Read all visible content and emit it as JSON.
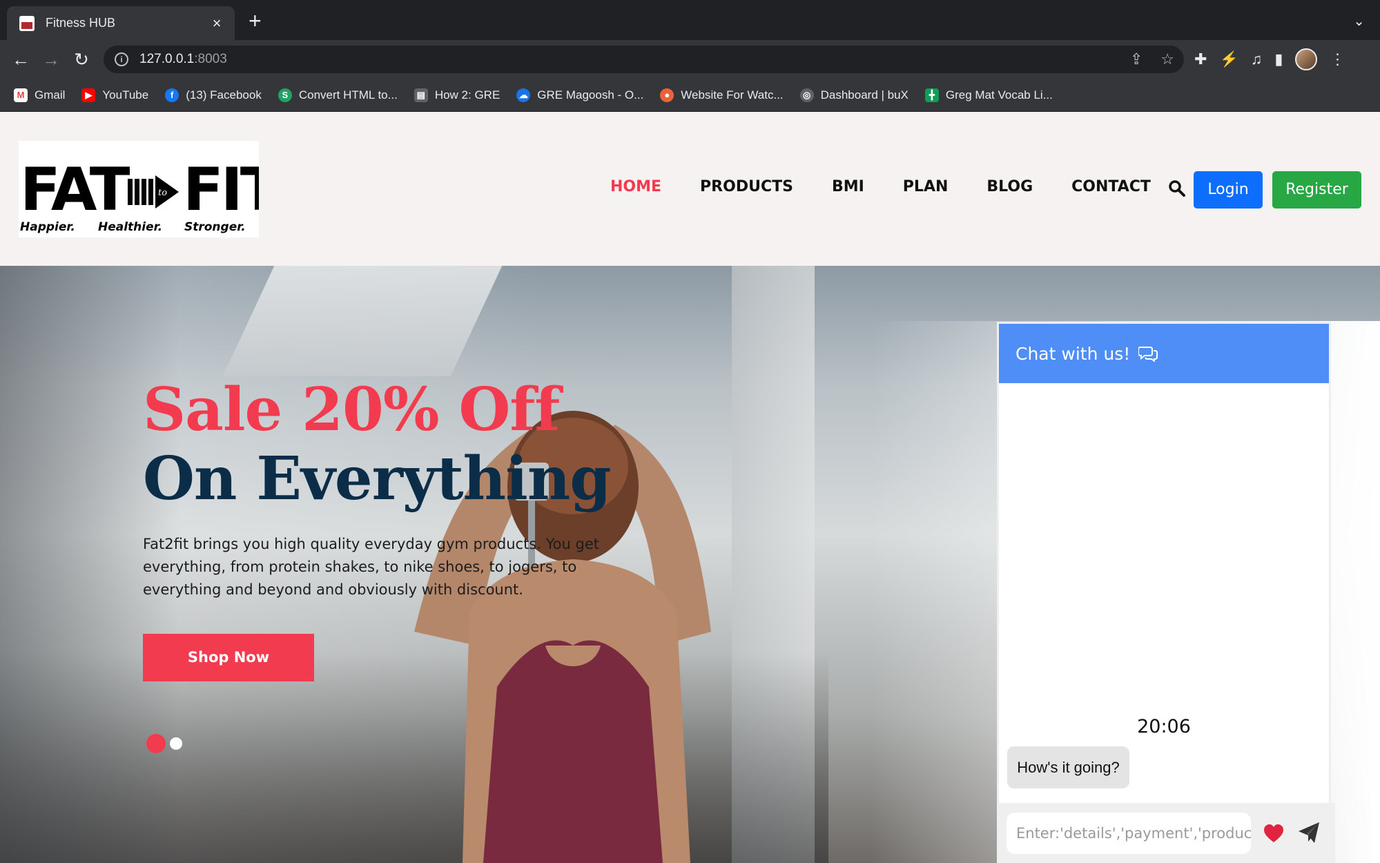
{
  "browser": {
    "tab_title": "Fitness HUB",
    "url_host": "127.0.0.1",
    "url_port": ":8003",
    "bookmarks": [
      {
        "label": "Gmail",
        "icon": "gmail-icon",
        "color": "#ea4335"
      },
      {
        "label": "YouTube",
        "icon": "youtube-icon",
        "color": "#ff0000"
      },
      {
        "label": "(13) Facebook",
        "icon": "facebook-icon",
        "color": "#1877f2"
      },
      {
        "label": "Convert HTML to...",
        "icon": "convert-icon",
        "color": "#21a366"
      },
      {
        "label": "How 2: GRE",
        "icon": "doc-icon",
        "color": "#9aa0a6"
      },
      {
        "label": "GRE Magoosh - O...",
        "icon": "cloud-icon",
        "color": "#1a73e8"
      },
      {
        "label": "Website For Watc...",
        "icon": "watch-icon",
        "color": "#e8623a"
      },
      {
        "label": "Dashboard | buX",
        "icon": "dashboard-icon",
        "color": "#9aa0a6"
      },
      {
        "label": "Greg Mat Vocab Li...",
        "icon": "sheets-icon",
        "color": "#0f9d58"
      }
    ]
  },
  "logo": {
    "word_left": "FAT",
    "word_mid": "to",
    "word_right": "FIT",
    "tagline_1": "Happier.",
    "tagline_2": "Healthier.",
    "tagline_3": "Stronger."
  },
  "nav": {
    "items": [
      "HOME",
      "PRODUCTS",
      "BMI",
      "PLAN",
      "BLOG",
      "CONTACT"
    ],
    "active": "HOME",
    "login": "Login",
    "register": "Register"
  },
  "hero": {
    "headline_1": "Sale 20% Off",
    "headline_2": "On Everything",
    "description": "Fat2fit brings you high quality everyday gym products. You get everything, from protein shakes, to nike shoes, to jogers, to everything and beyond and obviously with discount.",
    "cta": "Shop Now"
  },
  "chat": {
    "title": "Chat with us!",
    "time": "20:06",
    "message": "How's it going?",
    "placeholder": "Enter:'details','payment','products'"
  },
  "colors": {
    "accent": "#f33b50",
    "headline_dark": "#0c2d48",
    "login": "#0d6efd",
    "register": "#28a745",
    "chat_header": "#4f8ef7"
  }
}
